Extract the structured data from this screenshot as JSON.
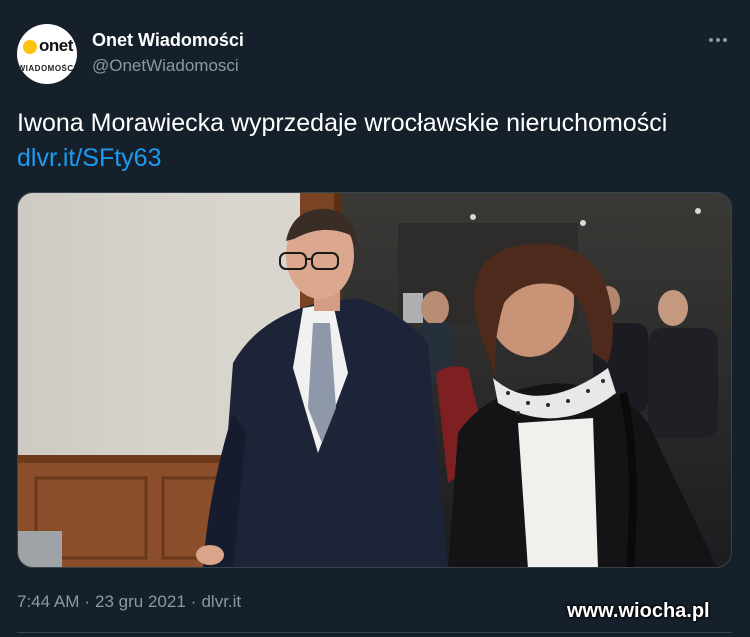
{
  "author": {
    "display_name": "Onet Wiadomości",
    "handle": "@OnetWiadomosci",
    "avatar_logo_text": "onet",
    "avatar_logo_sub": "WIADOMOŚCI"
  },
  "tweet": {
    "text": "Iwona Morawiecka wyprzedaje wrocławskie nieruchomości ",
    "link": "dlvr.it/SFty63"
  },
  "meta": {
    "time": "7:44 AM",
    "separator": "·",
    "date": "23 gru 2021",
    "source": "dlvr.it"
  },
  "watermark": "www.wiocha.pl",
  "colors": {
    "background": "#15202b",
    "link": "#1d9bf0",
    "secondary_text": "#8b98a5",
    "avatar_dot": "#ffc20e"
  },
  "icons": {
    "more": "more-horizontal-icon"
  }
}
